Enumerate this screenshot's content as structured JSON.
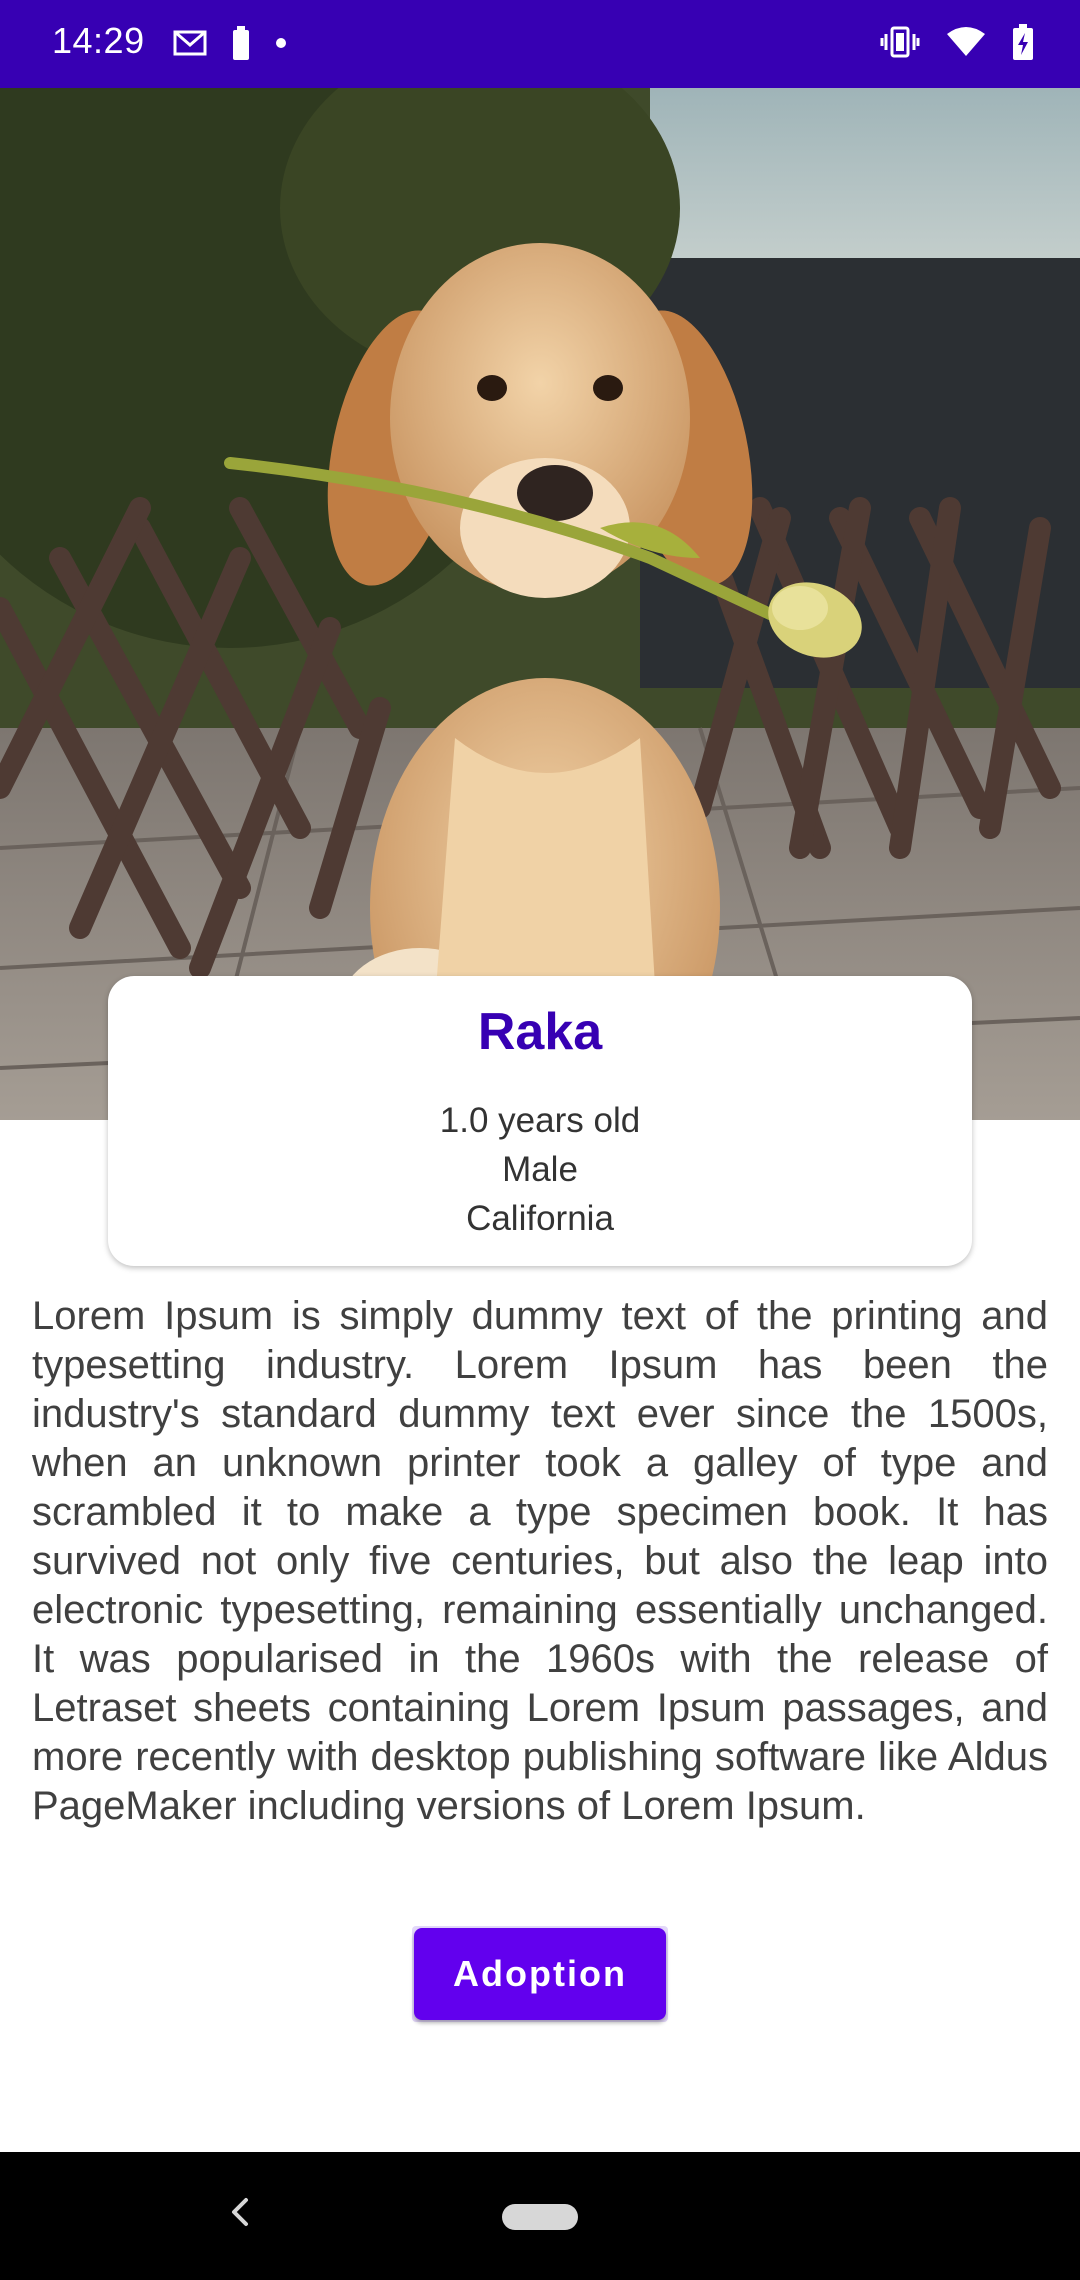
{
  "status_bar": {
    "time": "14:29",
    "left_icons": [
      "gmail-icon",
      "battery-small-icon",
      "dot-icon"
    ],
    "right_icons": [
      "vibrate-icon",
      "wifi-icon",
      "battery-charging-icon"
    ],
    "background": "#3700B3"
  },
  "hero": {
    "image_subject": "dog-with-tulip-photo"
  },
  "pet": {
    "name": "Raka",
    "age": "1.0 years old",
    "gender": "Male",
    "location": "California"
  },
  "description": "Lorem Ipsum is simply dummy text of the printing and typesetting industry. Lorem Ipsum has been the industry's standard dummy text ever since the 1500s, when an unknown printer took a galley of type and scrambled it to make a type specimen book. It has survived not only five centuries, but also the leap into electronic typesetting, remaining essentially unchanged. It was popularised in the 1960s with the release of Letraset sheets containing Lorem Ipsum passages, and more recently with desktop publishing software like Aldus PageMaker including versions of Lorem Ipsum.",
  "actions": {
    "adopt_label": "Adoption"
  },
  "colors": {
    "primary_dark": "#3700B3",
    "primary": "#6200EE"
  },
  "nav_bar": {
    "icons": [
      "back-icon",
      "home-pill-icon"
    ]
  }
}
